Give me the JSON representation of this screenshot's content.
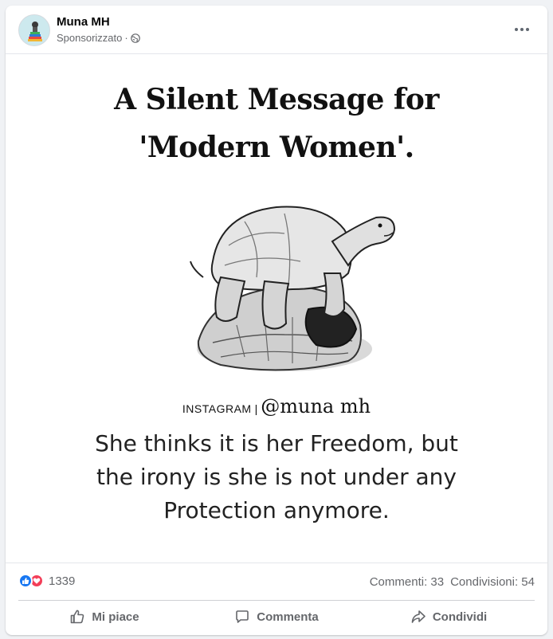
{
  "post": {
    "author": "Muna MH",
    "sponsored_label": "Sponsorizzato",
    "separator": "·",
    "audience_icon": "globe-icon",
    "more_icon": "more-options-icon"
  },
  "image": {
    "title_line1": "A Silent Message for",
    "title_line2": "'Modern Women'.",
    "instagram_label": "INSTAGRAM",
    "instagram_separator": "|",
    "instagram_handle": "@muna mh",
    "text_line1": "She thinks it is her Freedom, but",
    "text_line2": "the irony is she is not under any",
    "text_line3": "Protection anymore."
  },
  "stats": {
    "reaction_icons": [
      "like-icon",
      "love-icon"
    ],
    "reaction_count": "1339",
    "comments": "Commenti: 33",
    "shares": "Condivisioni: 54"
  },
  "actions": {
    "like_label": "Mi piace",
    "comment_label": "Commenta",
    "share_label": "Condividi"
  },
  "colors": {
    "like_blue": "#1877f2",
    "love_red": "#f33e58",
    "secondary_text": "#65676b",
    "background": "#f0f2f5"
  }
}
